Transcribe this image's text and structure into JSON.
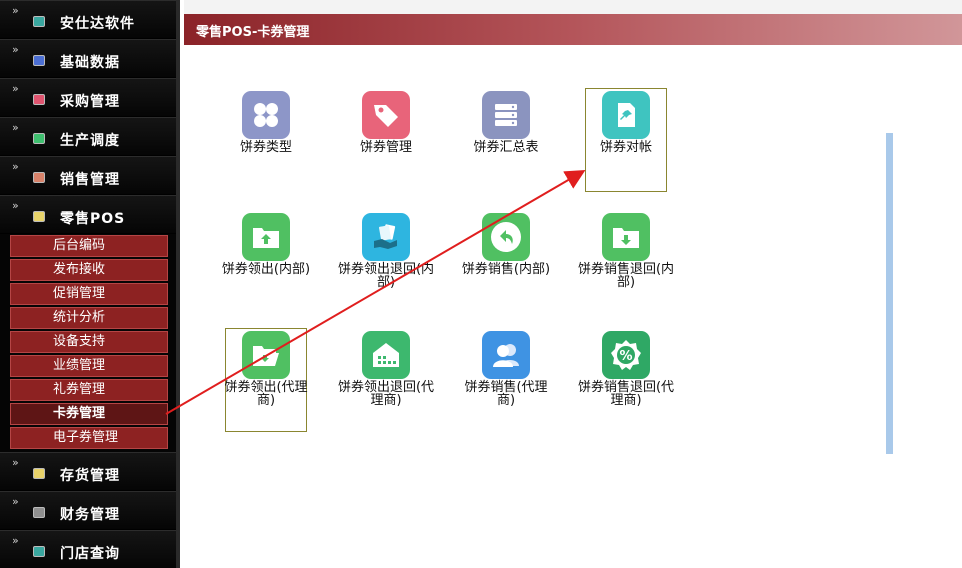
{
  "sidebar": {
    "items": [
      {
        "label": "安仕达软件",
        "color": "#3aa7a0",
        "icon": "app-icon"
      },
      {
        "label": "基础数据",
        "color": "#4c6fd3",
        "icon": "data-icon"
      },
      {
        "label": "采购管理",
        "color": "#e05570",
        "icon": "purchase-icon"
      },
      {
        "label": "生产调度",
        "color": "#3fbf6f",
        "icon": "production-icon"
      },
      {
        "label": "销售管理",
        "color": "#d8826a",
        "icon": "sales-icon"
      },
      {
        "label": "零售POS",
        "color": "#e8d36a",
        "icon": "pos-icon"
      }
    ],
    "sub_items": [
      {
        "label": "后台编码"
      },
      {
        "label": "发布接收"
      },
      {
        "label": "促销管理"
      },
      {
        "label": "统计分析"
      },
      {
        "label": "设备支持"
      },
      {
        "label": "业绩管理"
      },
      {
        "label": "礼券管理"
      },
      {
        "label": "卡券管理",
        "active": true
      },
      {
        "label": "电子券管理"
      }
    ],
    "items_after": [
      {
        "label": "存货管理",
        "color": "#e8d36a",
        "icon": "inventory-icon"
      },
      {
        "label": "财务管理",
        "color": "#8f8f8f",
        "icon": "finance-icon"
      },
      {
        "label": "门店查询",
        "color": "#3aa7a0",
        "icon": "store-icon"
      }
    ],
    "arrow_glyph": "»",
    "expanded_arrow_glyph": "¥"
  },
  "header": {
    "title": "零售POS-卡券管理"
  },
  "tiles": [
    {
      "label": "饼券类型",
      "color": "#8d96c8",
      "icon": "grid-icon"
    },
    {
      "label": "饼券管理",
      "color": "#e8647a",
      "icon": "tag-icon"
    },
    {
      "label": "饼券汇总表",
      "color": "#8b94bf",
      "icon": "database-icon"
    },
    {
      "label": "饼券对帐",
      "color": "#3fc4c0",
      "icon": "pin-document-icon"
    },
    {
      "label": "饼券领出(内部)",
      "color": "#50c062",
      "icon": "folder-upload-icon"
    },
    {
      "label": "饼券领出退回(内部)",
      "color": "#2eb5e0",
      "icon": "hand-money-icon"
    },
    {
      "label": "饼券销售(内部)",
      "color": "#50c062",
      "icon": "undo-icon"
    },
    {
      "label": "饼券销售退回(内部)",
      "color": "#50c062",
      "icon": "folder-download-icon"
    },
    {
      "label": "饼券领出(代理商)",
      "color": "#50c062",
      "icon": "folder-open-icon"
    },
    {
      "label": "饼券领出退回(代理商)",
      "color": "#3db86e",
      "icon": "warehouse-icon"
    },
    {
      "label": "饼券销售(代理商)",
      "color": "#3f93e3",
      "icon": "users-icon"
    },
    {
      "label": "饼券销售退回(代理商)",
      "color": "#2fa865",
      "icon": "discount-badge-icon"
    }
  ]
}
